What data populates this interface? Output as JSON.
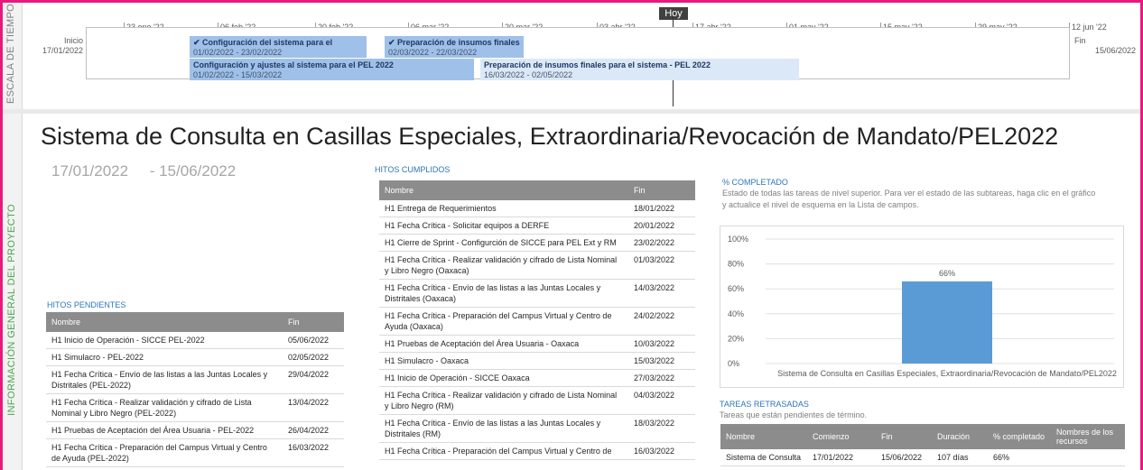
{
  "timeline": {
    "side_label": "ESCALA DE TIEMPO",
    "today_label": "Hoy",
    "start": {
      "label": "Inicio",
      "date": "17/01/2022"
    },
    "end": {
      "label": "Fin",
      "date": "15/06/2022"
    },
    "ticks": [
      "23 ene '22",
      "06 feb '22",
      "20 feb '22",
      "06 mar '22",
      "20 mar '22",
      "03 abr '22",
      "17 abr '22",
      "01 may '22",
      "15 may '22",
      "29 may '22",
      "12 jun '22"
    ],
    "bars": [
      {
        "name": "✔ Configuración del sistema para el",
        "dates": "01/02/2022 - 23/02/2022"
      },
      {
        "name": "✔ Preparación de insumos finales",
        "dates": "02/03/2022 - 22/03/2022"
      },
      {
        "name": "Configuración y ajustes al sistema para el PEL 2022",
        "dates": "01/02/2022 - 15/03/2022"
      },
      {
        "name": "Preparación de insumos finales para el sistema - PEL 2022",
        "dates": "16/03/2022 - 02/05/2022"
      }
    ]
  },
  "project": {
    "side_label": "INFORMACIÓN GENERAL DEL PROYECTO",
    "title": "Sistema de Consulta en Casillas Especiales, Extraordinaria/Revocación de Mandato/PEL2022",
    "start_date": "17/01/2022",
    "end_date": "- 15/06/2022"
  },
  "hitos_pendientes": {
    "label": "HITOS PENDIENTES",
    "columns": [
      "Nombre",
      "Fin"
    ],
    "rows": [
      [
        "H1 Inicio de Operación - SICCE PEL-2022",
        "05/06/2022"
      ],
      [
        "H1 Simulacro - PEL-2022",
        "02/05/2022"
      ],
      [
        "H1 Fecha Crítica - Envío de las listas a las Juntas Locales y Distritales (PEL-2022)",
        "29/04/2022"
      ],
      [
        "H1 Fecha Crítica - Realizar validación y cifrado de Lista Nominal y Libro Negro (PEL-2022)",
        "13/04/2022"
      ],
      [
        "H1 Pruebas de Aceptación del Área Usuaria - PEL-2022",
        "26/04/2022"
      ],
      [
        "H1 Fecha Crítica - Preparación del Campus Virtual y Centro de Ayuda (PEL-2022)",
        "16/03/2022"
      ]
    ]
  },
  "hitos_cumplidos": {
    "label": "HITOS CUMPLIDOS",
    "columns": [
      "Nombre",
      "Fin"
    ],
    "rows": [
      [
        "H1 Entrega de Requerimientos",
        "18/01/2022"
      ],
      [
        "H1 Fecha Crítica - Solicitar equipos a DERFE",
        "20/01/2022"
      ],
      [
        "H1 Cierre de Sprint - Configurción de SICCE para PEL Ext y RM",
        "23/02/2022"
      ],
      [
        "H1 Fecha Crítica - Realizar validación y cifrado de Lista Nominal y Libro Negro (Oaxaca)",
        "01/03/2022"
      ],
      [
        "H1 Fecha Crítica - Envío de las listas a las Juntas Locales y Distritales (Oaxaca)",
        "14/03/2022"
      ],
      [
        "H1 Fecha Crítica - Preparación del Campus Virtual y Centro de Ayuda (Oaxaca)",
        "24/02/2022"
      ],
      [
        "H1 Pruebas de Aceptación del Área Usuaria - Oaxaca",
        "10/03/2022"
      ],
      [
        "H1 Simulacro - Oaxaca",
        "15/03/2022"
      ],
      [
        "H1 Inicio de Operación - SICCE Oaxaca",
        "27/03/2022"
      ],
      [
        "H1 Fecha Crítica - Realizar validación y cifrado de Lista Nominal y Libro Negro (RM)",
        "04/03/2022"
      ],
      [
        "H1 Fecha Crítica - Envío de las listas a las Juntas Locales y Distritales (RM)",
        "18/03/2022"
      ],
      [
        "H1 Fecha Crítica - Preparación del Campus Virtual y Centro de",
        "16/03/2022"
      ]
    ]
  },
  "completado": {
    "label": "% COMPLETADO",
    "description": "Estado de todas las tareas de nivel superior. Para ver el estado de las subtareas, haga clic en el gráfico y actualice el nivel de esquema en la Lista de campos."
  },
  "chart_data": {
    "type": "bar",
    "categories": [
      "Sistema de Consulta en Casillas Especiales, Extraordinaria/Revocación de Mandato/PEL2022"
    ],
    "values": [
      66
    ],
    "data_labels": [
      "66%"
    ],
    "y_ticks": [
      "0%",
      "20%",
      "40%",
      "60%",
      "80%",
      "100%"
    ],
    "ylim": [
      0,
      100
    ],
    "bar_color": "#5b9bd5",
    "grid": true
  },
  "tareas_retrasadas": {
    "label": "TAREAS RETRASADAS",
    "description": "Tareas que están pendientes de término.",
    "columns": [
      "Nombre",
      "Comienzo",
      "Fin",
      "Duración",
      "% completado",
      "Nombres de los recursos"
    ],
    "rows": [
      [
        "Sistema de Consulta",
        "17/01/2022",
        "15/06/2022",
        "107 días",
        "66%",
        ""
      ]
    ]
  },
  "colors": {
    "accent_border": "#e8197d",
    "section_label": "#2e75b6",
    "table_header": "#8c8c8c"
  }
}
